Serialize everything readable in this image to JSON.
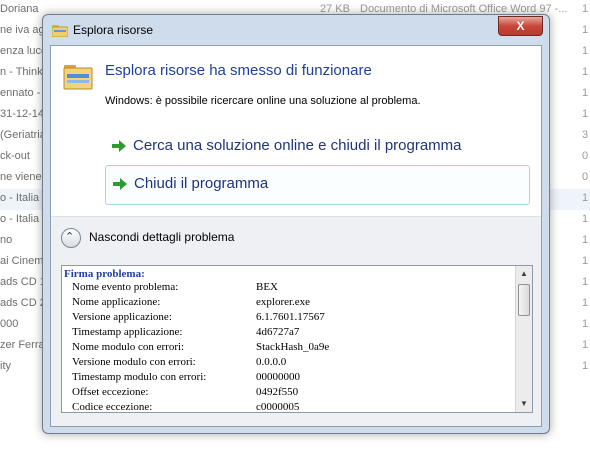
{
  "background": {
    "rows": [
      {
        "name": "Doriana",
        "size": "27 KB",
        "type": "Documento di Microsoft Office Word 97 -...",
        "date": "1"
      },
      {
        "name": "ne iva ag",
        "size": "",
        "type": "",
        "date": "1"
      },
      {
        "name": "enza luce",
        "size": "",
        "type": "",
        "date": "1"
      },
      {
        "name": "n - Thinki",
        "size": "",
        "type": "",
        "date": "1"
      },
      {
        "name": "ennato -",
        "size": "",
        "type": "",
        "date": "1"
      },
      {
        "name": "31-12-14",
        "size": "",
        "type": "",
        "date": "1"
      },
      {
        "name": "(Geriatria",
        "size": "",
        "type": "",
        "date": "3"
      },
      {
        "name": "ck-out",
        "size": "",
        "type": "",
        "date": "0"
      },
      {
        "name": "ne viene",
        "size": "",
        "type": "",
        "date": "0"
      },
      {
        "name": "o - Italia",
        "size": "",
        "type": "",
        "date": "1"
      },
      {
        "name": "o - Italia",
        "size": "",
        "type": "",
        "date": "1"
      },
      {
        "name": "no",
        "size": "",
        "type": "",
        "date": "1"
      },
      {
        "name": "ai Cinema",
        "size": "",
        "type": "",
        "date": "1"
      },
      {
        "name": "ads CD 1",
        "size": "",
        "type": "",
        "date": "1"
      },
      {
        "name": "ads CD 2",
        "size": "",
        "type": "",
        "date": "1"
      },
      {
        "name": "000",
        "size": "",
        "type": "",
        "date": "1"
      },
      {
        "name": "zer Ferra",
        "size": "",
        "type": "",
        "date": "1"
      },
      {
        "name": "ity",
        "size": "",
        "type": "",
        "date": "1"
      }
    ]
  },
  "window": {
    "title": "Esplora risorse",
    "close_label": "X"
  },
  "header": {
    "title": "Esplora risorse ha smesso di funzionare",
    "message": "Windows: è possibile ricercare online una soluzione al problema."
  },
  "commands": {
    "search_online": "Cerca una soluzione online e chiudi il programma",
    "close_program": "Chiudi il programma"
  },
  "details_toggle": {
    "label": "Nascondi dettagli problema",
    "glyph": "⌃"
  },
  "details": {
    "heading": "Firma problema:",
    "rows": [
      {
        "key": "Nome evento problema:",
        "value": "BEX"
      },
      {
        "key": "Nome applicazione:",
        "value": "explorer.exe"
      },
      {
        "key": "Versione applicazione:",
        "value": "6.1.7601.17567"
      },
      {
        "key": "Timestamp applicazione:",
        "value": "4d6727a7"
      },
      {
        "key": "Nome modulo con errori:",
        "value": "StackHash_0a9e"
      },
      {
        "key": "Versione modulo con errori:",
        "value": "0.0.0.0"
      },
      {
        "key": "Timestamp modulo con errori:",
        "value": "00000000"
      },
      {
        "key": "Offset eccezione:",
        "value": "0492f550"
      },
      {
        "key": "Codice eccezione:",
        "value": "c0000005"
      }
    ]
  },
  "colors": {
    "title_blue": "#1f3f9e",
    "command_blue": "#1f3577",
    "arrow_green": "#2e9b2e"
  }
}
